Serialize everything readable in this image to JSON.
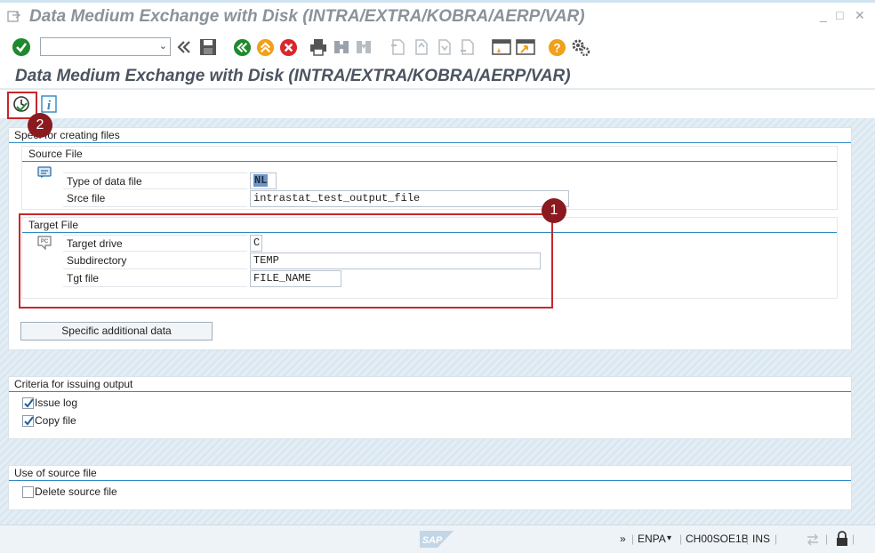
{
  "window": {
    "title": "Data Medium Exchange with Disk (INTRA/EXTRA/KOBRA/AERP/VAR)",
    "minimize_glyph": "_",
    "maximize_glyph": "□",
    "close_glyph": "✕"
  },
  "toolbar": {
    "command_field_value": "",
    "icons": [
      "enter-icon",
      "back-double-icon",
      "save-icon",
      "back-icon",
      "exit-icon",
      "cancel-icon",
      "print-icon",
      "find-icon",
      "find-next-icon",
      "first-page-icon",
      "previous-page-icon",
      "next-page-icon",
      "last-page-icon",
      "create-session-icon",
      "shortcut-icon",
      "help-icon",
      "settings-icon"
    ]
  },
  "screen": {
    "title": "Data Medium Exchange with Disk (INTRA/EXTRA/KOBRA/AERP/VAR)"
  },
  "app_toolbar": {
    "icons": [
      "execute-icon",
      "info-icon"
    ]
  },
  "spec_group": {
    "title": "Spec. for creating files",
    "source_file": {
      "title": "Source File",
      "rows": [
        {
          "label": "Type of data file",
          "value": "NL"
        },
        {
          "label": "Srce file",
          "value": "intrastat_test_output_file"
        }
      ]
    },
    "target_file": {
      "title": "Target File",
      "rows": [
        {
          "label": "Target drive",
          "value": "C"
        },
        {
          "label": "Subdirectory",
          "value": "TEMP"
        },
        {
          "label": "Tgt file",
          "value": "FILE_NAME"
        }
      ]
    },
    "additional_button": "Specific additional data"
  },
  "criteria_group": {
    "title": "Criteria for issuing output",
    "options": [
      {
        "label": "Issue log",
        "checked": true
      },
      {
        "label": "Copy file",
        "checked": true
      }
    ]
  },
  "source_use_group": {
    "title": "Use of source file",
    "options": [
      {
        "label": "Delete source file",
        "checked": false
      }
    ]
  },
  "callouts": {
    "one": "1",
    "two": "2",
    "color": "#c8262b",
    "badge_color": "#8a1a1f"
  },
  "statusbar": {
    "expand": "»",
    "system": "ENPA",
    "client_server": "CH00SOE1B",
    "mode": "INS",
    "logo": "SAP"
  },
  "colors": {
    "accent_blue": "#2f87c4",
    "ok_green": "#1f8a2d",
    "cancel_red": "#d9272e",
    "help_orange": "#f0a01a"
  }
}
